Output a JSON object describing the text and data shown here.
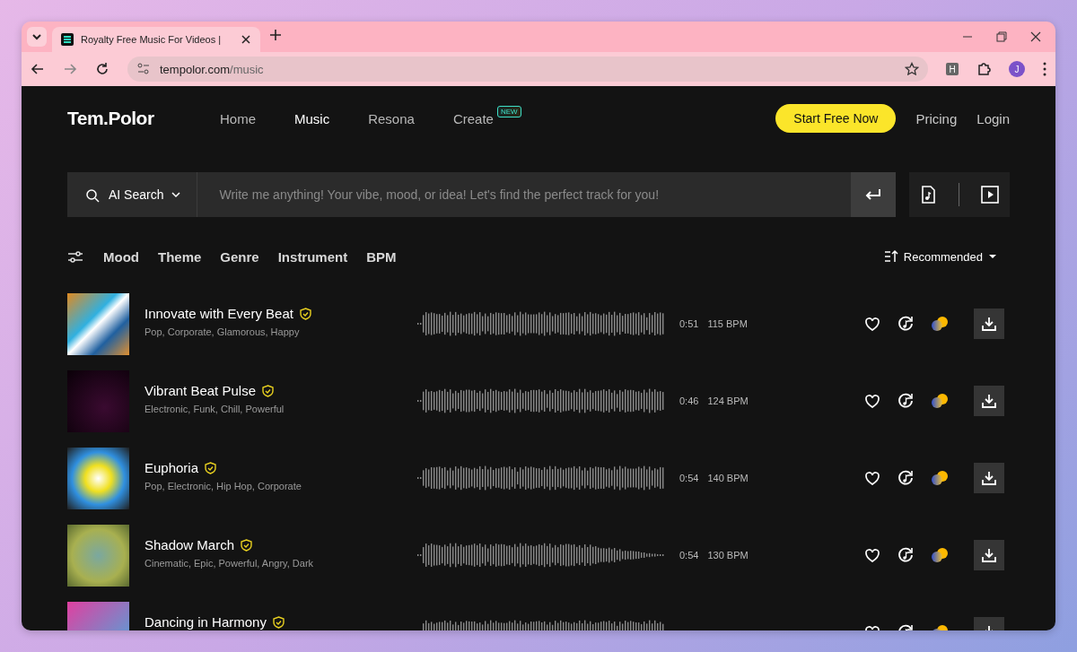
{
  "browser": {
    "tab_title": "Royalty Free Music For Videos |",
    "url_host": "tempolor.com",
    "url_path": "/music",
    "extension_letter": "H",
    "profile_initial": "J"
  },
  "site": {
    "logo": "Tem.Polor",
    "nav": [
      {
        "label": "Home",
        "selected": false
      },
      {
        "label": "Music",
        "selected": true
      },
      {
        "label": "Resona",
        "selected": false
      },
      {
        "label": "Create",
        "selected": false,
        "badge": "NEW"
      }
    ],
    "cta": "Start Free Now",
    "links": [
      "Pricing",
      "Login"
    ]
  },
  "search": {
    "mode": "AI Search",
    "placeholder": "Write me anything! Your vibe, mood, or idea! Let's find the perfect track for you!"
  },
  "filters": [
    "Mood",
    "Theme",
    "Genre",
    "Instrument",
    "BPM"
  ],
  "sort": "Recommended",
  "tracks": [
    {
      "title": "Innovate with Every Beat",
      "verified": true,
      "tags": "Pop, Corporate, Glamorous, Happy",
      "duration": "0:51",
      "bpm": "115 BPM"
    },
    {
      "title": "Vibrant Beat Pulse",
      "verified": true,
      "tags": "Electronic, Funk, Chill, Powerful",
      "duration": "0:46",
      "bpm": "124 BPM"
    },
    {
      "title": "Euphoria",
      "verified": true,
      "tags": "Pop, Electronic, Hip Hop, Corporate",
      "duration": "0:54",
      "bpm": "140 BPM"
    },
    {
      "title": "Shadow March",
      "verified": true,
      "tags": "Cinematic, Epic, Powerful, Angry, Dark",
      "duration": "0:54",
      "bpm": "130 BPM"
    },
    {
      "title": "Dancing in Harmony",
      "verified": true
    }
  ]
}
